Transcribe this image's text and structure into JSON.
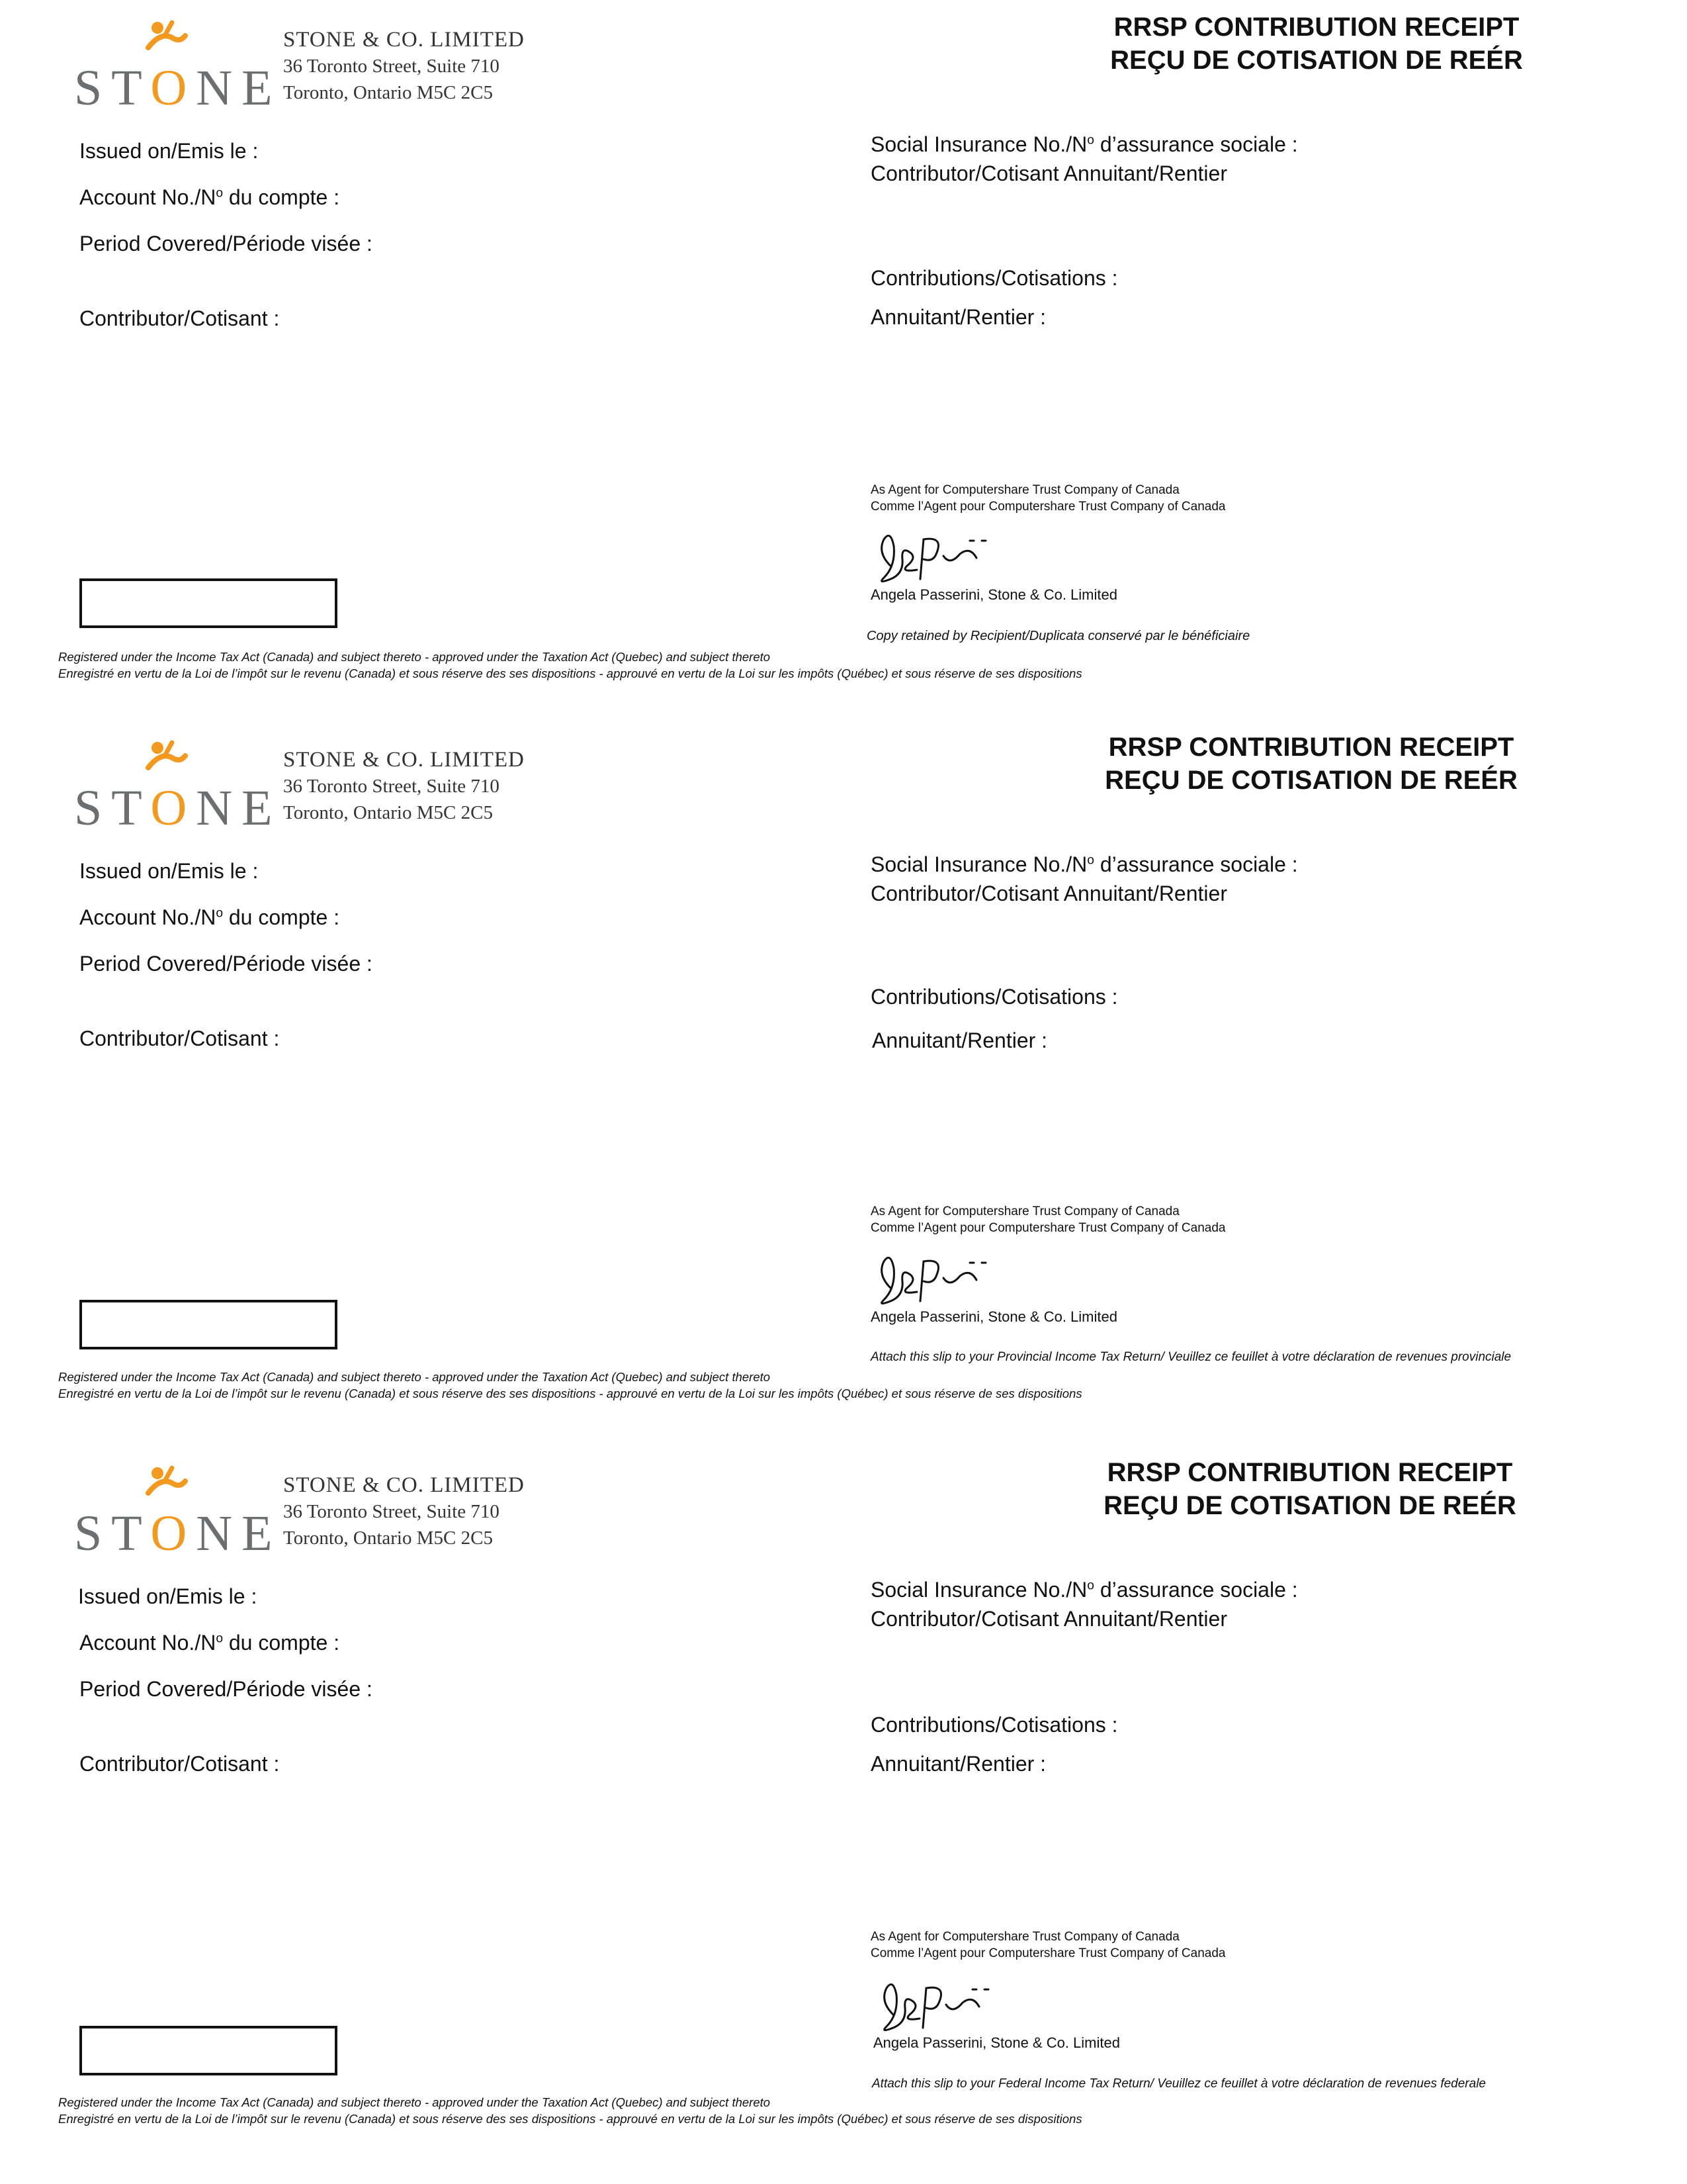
{
  "company": {
    "logo_word": "STONE",
    "name": "STONE & CO. LIMITED",
    "address_line1": "36 Toronto Street, Suite 710",
    "address_line2": "Toronto, Ontario  M5C  2C5"
  },
  "receipt": {
    "title_en": "RRSP CONTRIBUTION RECEIPT",
    "title_fr": "REÇU DE COTISATION DE REÉR"
  },
  "fields": {
    "issued_on": "Issued on/Emis le :",
    "account_no_prefix": "Account No./N",
    "account_no_suffix": "du compte :",
    "period_covered": "Period Covered/Période visée :",
    "contributor_left": "Contributor/Cotisant :",
    "sin_prefix": "Social Insurance No./N",
    "sin_suffix": "d’assurance sociale :",
    "contributor_annuitant": "Contributor/Cotisant   Annuitant/Rentier",
    "contributions": "Contributions/Cotisations :",
    "annuitant": "Annuitant/Rentier :",
    "superscript": "o"
  },
  "agent": {
    "line1": "As Agent for Computershare Trust Company of Canada",
    "line2": "Comme l’Agent pour Computershare Trust Company of  Canada",
    "signatory": "Angela Passerini, Stone & Co. Limited"
  },
  "slip_notes": [
    "Copy retained by Recipient/Duplicata conservé par le bénéficiaire",
    "Attach this slip to your Provincial Income Tax Return/ Veuillez ce feuillet à votre déclaration de revenues provinciale",
    "Attach this slip to your Federal Income Tax Return/ Veuillez ce feuillet à votre déclaration de revenues federale"
  ],
  "legal": {
    "line1": "Registered under the Income Tax Act (Canada) and subject thereto - approved under the Taxation Act (Quebec) and subject thereto",
    "line2": "Enregistré en vertu de la Loi de l’impôt sur le revenu (Canada) et sous réserve des ses dispositions - approuvé en vertu de la Loi sur les impôts (Québec) et sous réserve de ses dispositions"
  },
  "colors": {
    "brand_orange": "#f29a1f",
    "brand_gray": "#6d6e71"
  }
}
